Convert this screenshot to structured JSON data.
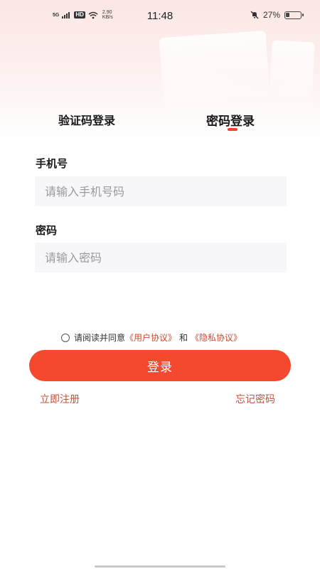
{
  "status_bar": {
    "network": "5G",
    "hd": "HD",
    "speed_value": "2.90",
    "speed_unit": "KB/s",
    "time": "11:48",
    "battery": "27%",
    "battery_level_percent": 27
  },
  "tabs": {
    "sms_login": "验证码登录",
    "password_login": "密码登录",
    "active": "password_login"
  },
  "form": {
    "phone_label": "手机号",
    "phone_placeholder": "请输入手机号码",
    "phone_value": "",
    "password_label": "密码",
    "password_placeholder": "请输入密码",
    "password_value": ""
  },
  "agreement": {
    "checked": false,
    "prefix": "请阅读并同意",
    "user_agreement": "《用户协议》",
    "and": "和",
    "privacy_policy": "《隐私协议》"
  },
  "buttons": {
    "login": "登录",
    "register": "立即注册",
    "forgot_password": "忘记密码"
  },
  "colors": {
    "accent": "#f4492f",
    "link": "#c0533a",
    "input_bg": "#f7f7fb"
  }
}
